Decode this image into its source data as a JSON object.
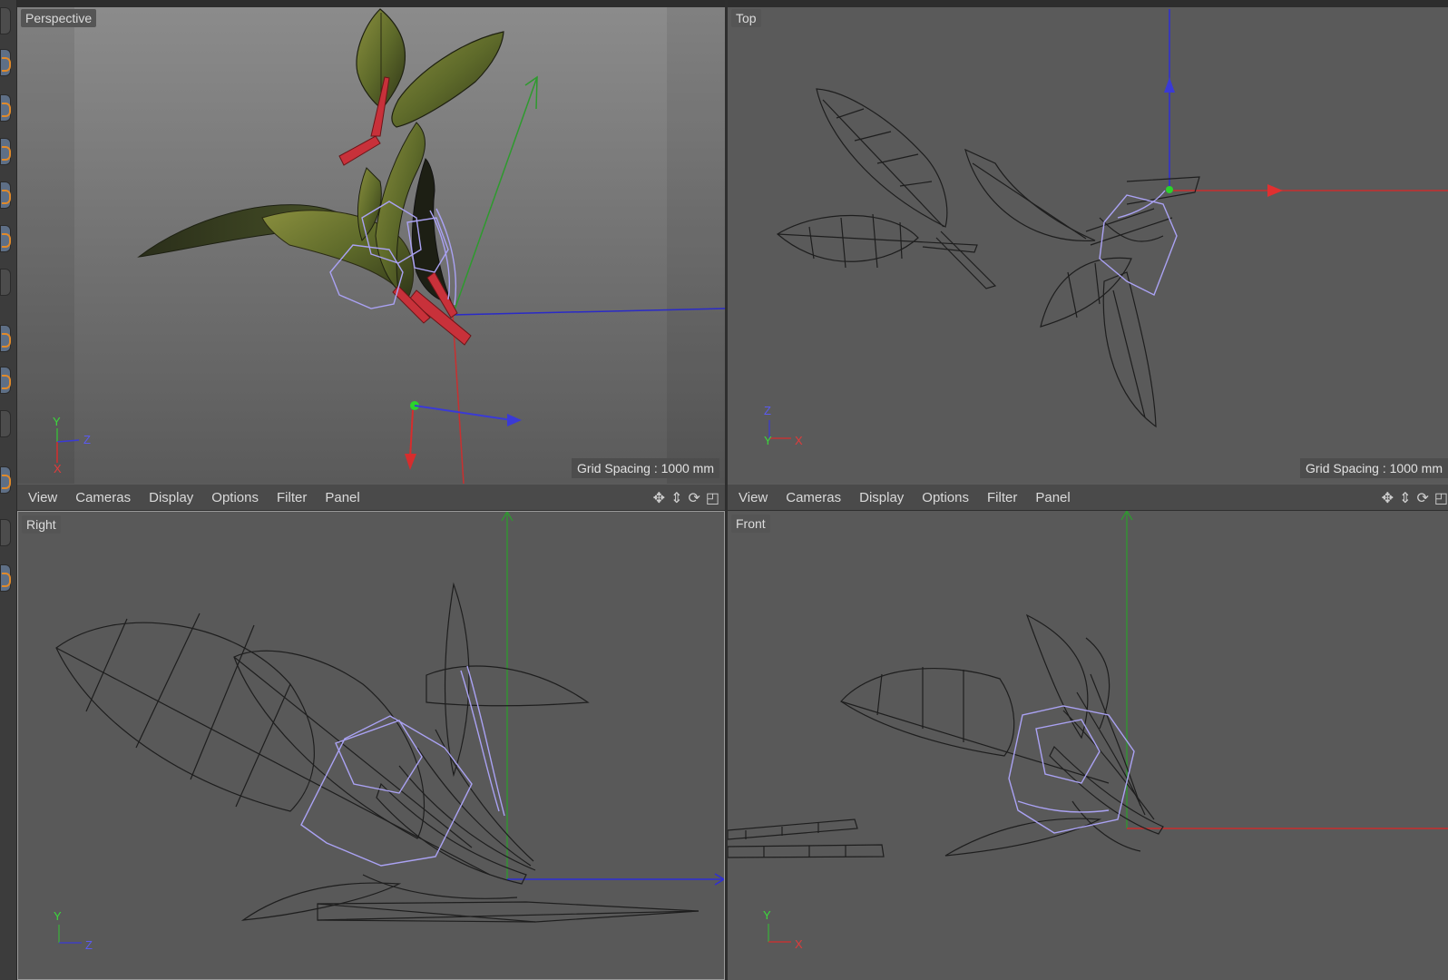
{
  "viewports": {
    "perspective": {
      "label": "Perspective",
      "grid_spacing": "Grid Spacing : 1000 mm"
    },
    "top": {
      "label": "Top",
      "grid_spacing": "Grid Spacing : 1000 mm"
    },
    "right": {
      "label": "Right"
    },
    "front": {
      "label": "Front"
    }
  },
  "menu_left": {
    "view": "View",
    "cameras": "Cameras",
    "display": "Display",
    "options": "Options",
    "filter": "Filter",
    "panel": "Panel"
  },
  "menu_right": {
    "view": "View",
    "cameras": "Cameras",
    "display": "Display",
    "options": "Options",
    "filter": "Filter",
    "panel": "Panel"
  },
  "axes": {
    "perspective": {
      "y": "Y",
      "z": "Z",
      "x": "X"
    },
    "top": {
      "z": "Z",
      "y": "Y",
      "x": "X"
    },
    "right": {
      "y": "Y",
      "z": "Z"
    },
    "front": {
      "y": "Y",
      "x": "X"
    }
  },
  "icons": [
    "move-icon",
    "up-down-icon",
    "rotate-icon",
    "maximize-icon"
  ],
  "colors": {
    "axis_x": "#d62d2d",
    "axis_y": "#3bb33b",
    "axis_z": "#3a3ad6",
    "selection": "#a9a2f2"
  }
}
